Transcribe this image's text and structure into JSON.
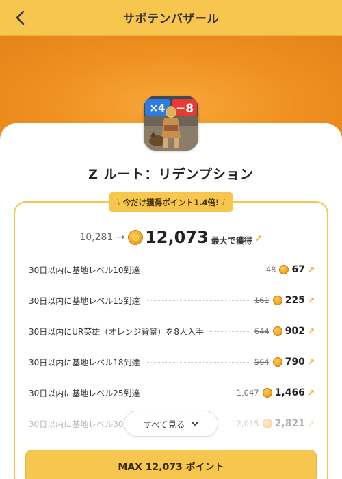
{
  "header": {
    "title": "サボテンバザール"
  },
  "game": {
    "title": "Z ルート：リデンプション",
    "icon_badges": [
      "×4",
      "−8"
    ]
  },
  "promo": {
    "text": "今だけ獲得ポイント1.4倍!"
  },
  "summary": {
    "old_total": "10,281",
    "new_total": "12,073",
    "max_label": "最大で獲得"
  },
  "tasks": [
    {
      "label": "30日以内に基地レベル10到達",
      "old": "48",
      "new": "67"
    },
    {
      "label": "30日以内に基地レベル15到達",
      "old": "161",
      "new": "225"
    },
    {
      "label": "30日以内にUR英雄（オレンジ背景）を8人入手",
      "old": "644",
      "new": "902"
    },
    {
      "label": "30日以内に基地レベル18到達",
      "old": "564",
      "new": "790"
    },
    {
      "label": "30日以内に基地レベル25到達",
      "old": "1,047",
      "new": "1,466"
    },
    {
      "label": "30日以内に基地レベル30到達",
      "old": "2,015",
      "new": "2,821"
    }
  ],
  "see_all": {
    "label": "すべて見る"
  },
  "cta": {
    "label": "MAX 12,073 ポイント"
  },
  "colors": {
    "accent": "#f6c64e",
    "hero_orange": "#ee8f1f",
    "coin": "#f3a623"
  }
}
